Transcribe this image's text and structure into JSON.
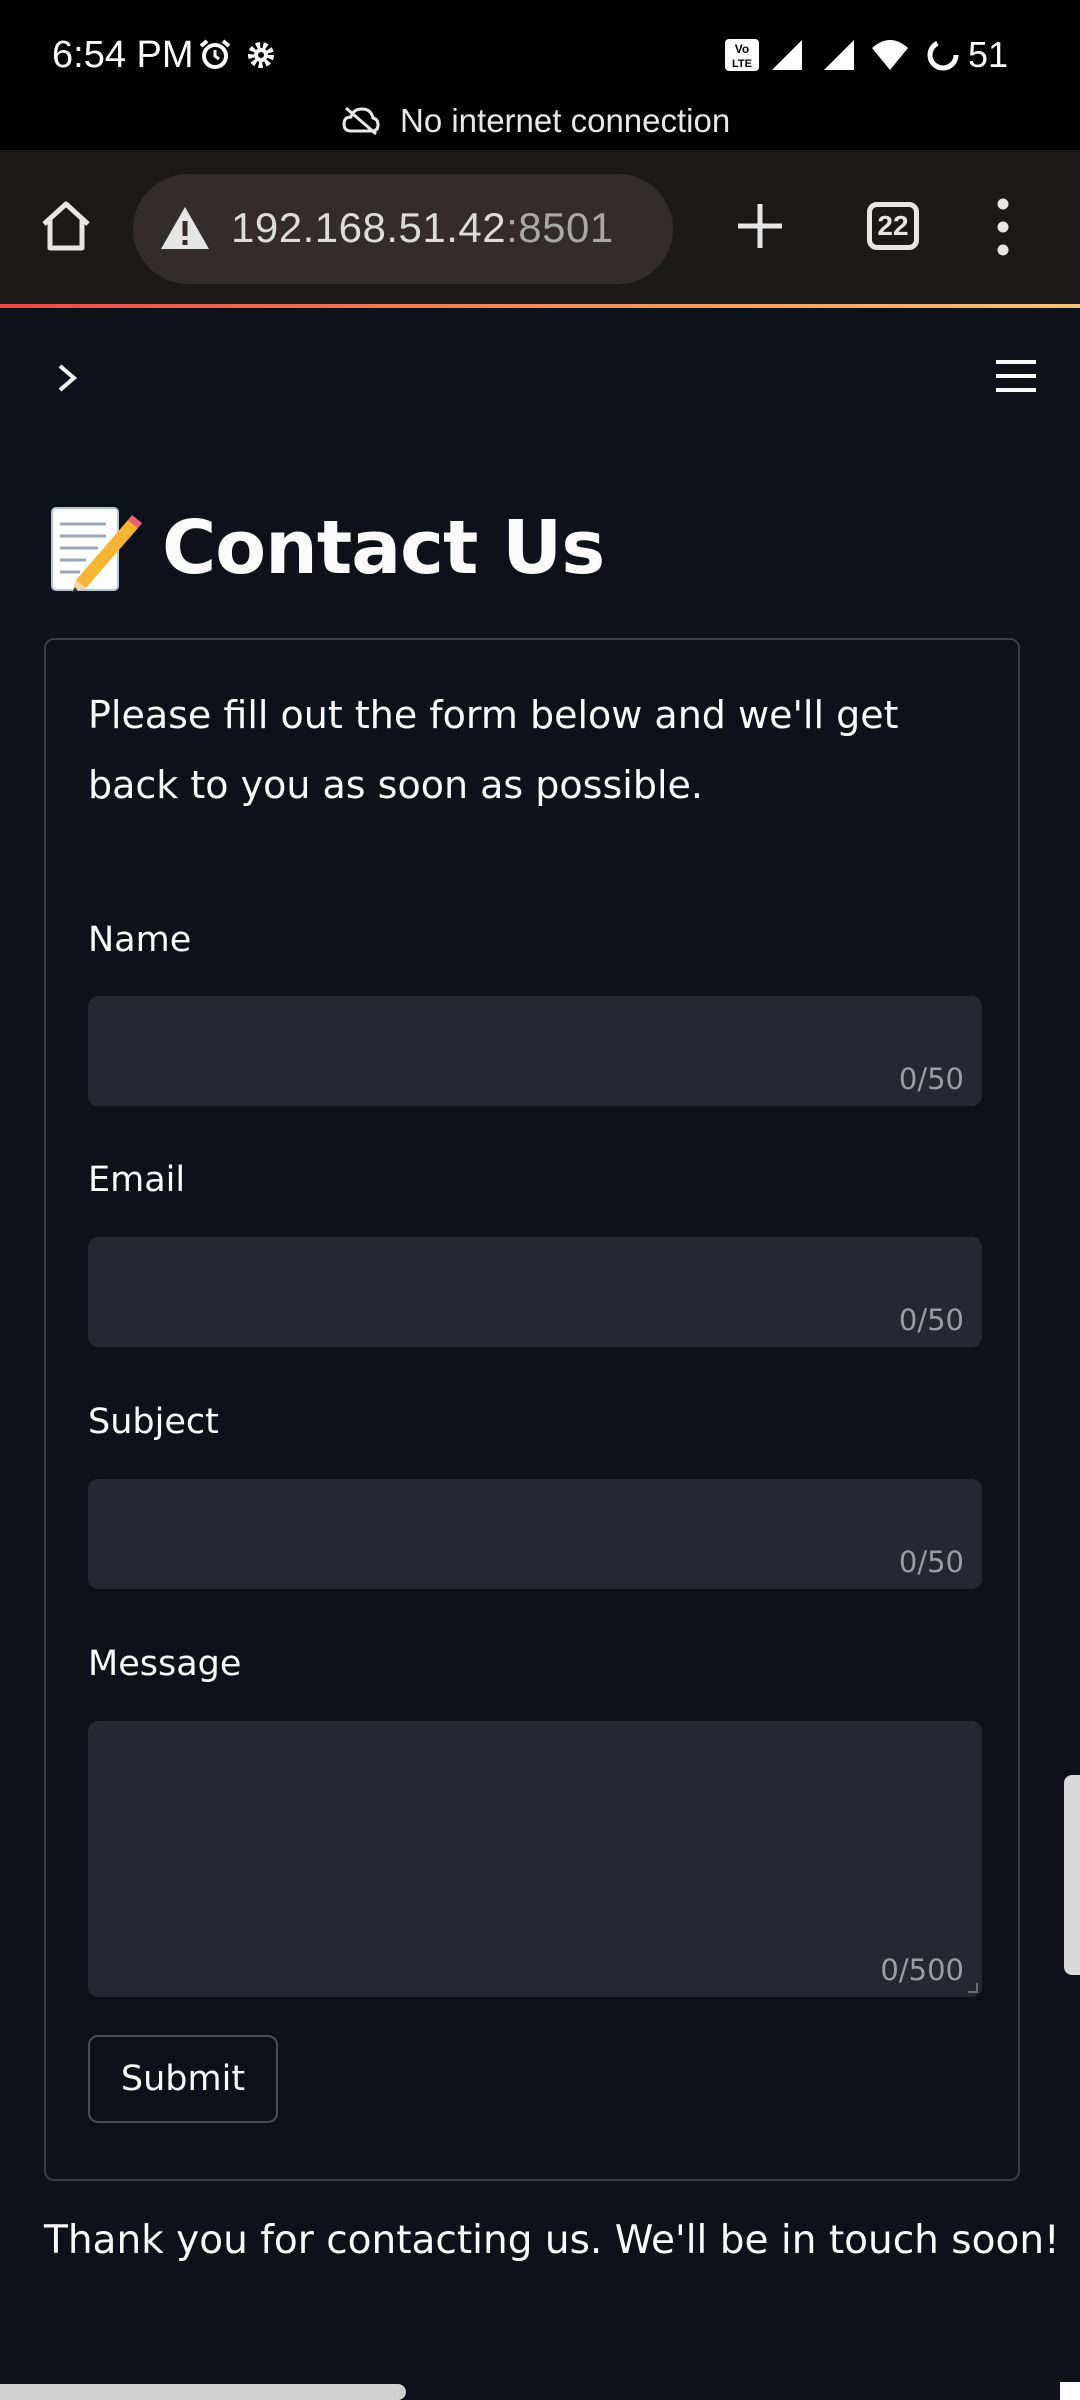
{
  "status_bar": {
    "time": "6:54 PM",
    "battery": "51",
    "icons": [
      "alarm-icon",
      "gear-icon",
      "volte-icon",
      "signal-icon",
      "signal-icon",
      "wifi-icon",
      "battery-icon"
    ]
  },
  "network_banner": {
    "text": "No internet connection",
    "icon": "cloud-off-icon"
  },
  "browser": {
    "url_host": "192.168.51.42",
    "url_port": ":8501",
    "tab_count": "22",
    "icons": [
      "home-icon",
      "warning-icon",
      "plus-icon",
      "tabs-icon",
      "more-vert-icon"
    ]
  },
  "app": {
    "title": "Contact Us",
    "title_icon": "memo-icon",
    "intro": "Please fill out the form below and we'll get back to you as soon as possible.",
    "fields": [
      {
        "label": "Name",
        "value": "",
        "counter": "0/50"
      },
      {
        "label": "Email",
        "value": "",
        "counter": "0/50"
      },
      {
        "label": "Subject",
        "value": "",
        "counter": "0/50"
      },
      {
        "label": "Message",
        "value": "",
        "counter": "0/500"
      }
    ],
    "submit_label": "Submit",
    "thanks": "Thank you for contacting us. We'll be in touch soon!"
  },
  "colors": {
    "background": "#0e1117",
    "input_bg": "#262730",
    "text": "#fafafa",
    "browser_bar": "#1c1919"
  }
}
